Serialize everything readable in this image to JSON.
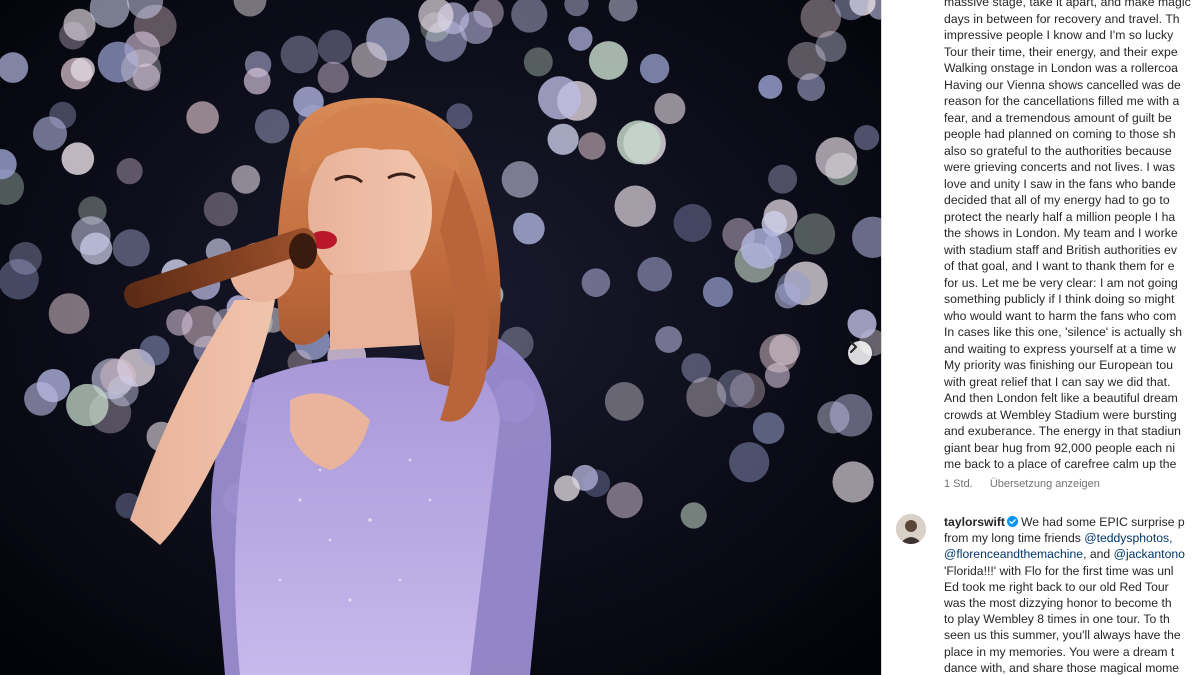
{
  "post": {
    "carousel_next_icon": "chevron-right-icon",
    "photo_description_icon": "concert-photo"
  },
  "caption": {
    "lines": [
      "massive stage, take it apart, and make magic",
      "days in between for recovery and travel. Th",
      "impressive people I know and I'm so lucky",
      "Tour their time, their energy, and their expe",
      "Walking onstage in London was a rollercoa",
      "Having our Vienna shows cancelled was de",
      "reason for the cancellations filled me with a",
      "fear, and a tremendous amount of guilt be",
      "people had planned on coming to those sh",
      "also so grateful to the authorities because",
      "were grieving concerts and not lives. I was",
      "love and unity I saw in the fans who bande",
      "decided that all of my energy had to go to",
      "protect the nearly half a million people I ha",
      "the shows in London. My team and I worke",
      "with stadium staff and British authorities ev",
      "of that goal, and I want to thank them for e",
      "for us. Let me be very clear: I am not going",
      "something publicly if I think doing so might",
      "who would want to harm the fans who com",
      "In cases like this one, 'silence' is actually sh",
      "and waiting to express yourself at a time w",
      "My priority was finishing our European tou",
      "with great relief that I can say we did that.",
      "And then London felt like a beautiful dream",
      "crowds at Wembley Stadium were bursting",
      "and exuberance. The energy in that stadiun",
      "giant bear hug from 92,000 people each ni",
      "me back to a place of carefree calm up the"
    ],
    "time_ago": "1 Std.",
    "translate_label": "Übersetzung anzeigen"
  },
  "comment": {
    "username": "taylorswift",
    "verified_icon": "verified-badge-icon",
    "line1": "We had some EPIC surprise p",
    "line2_prefix": "from my long time friends ",
    "line2_mention": "@teddysphotos,",
    "line3_mention1": "@florenceandthemachine",
    "line3_mid": ", and ",
    "line3_mention2": "@jackantono",
    "lines": [
      "'Florida!!!' with Flo for the first time was unl",
      "Ed took me right back to our old Red Tour",
      "was the most dizzying honor to become th",
      "to play Wembley 8 times in one tour. To th",
      "seen us this summer, you'll always have the",
      "place in my memories. You were a dream t",
      "dance with, and share those magical mome"
    ]
  },
  "colors": {
    "background": "#ffffff",
    "text": "#262626",
    "meta": "#737373",
    "mention": "#00376b",
    "verified": "#0095f6",
    "photo_bg": "#05060f",
    "dress": "#b9a9df",
    "hair": "#c9794a"
  }
}
